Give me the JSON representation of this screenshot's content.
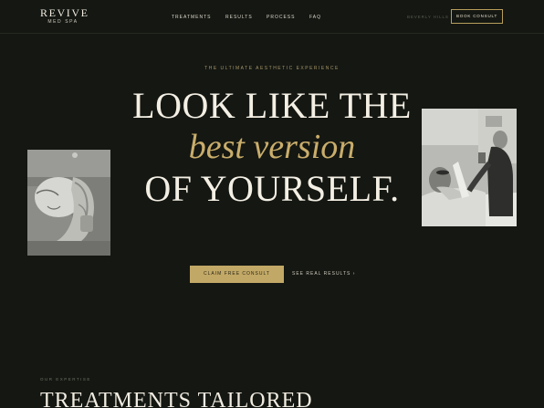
{
  "brand": {
    "name": "REVIVE",
    "subtitle": "MED SPA"
  },
  "nav": {
    "links": [
      {
        "label": "TREATMENTS"
      },
      {
        "label": "RESULTS"
      },
      {
        "label": "PROCESS"
      },
      {
        "label": "FAQ"
      }
    ],
    "location": "BEVERLY HILLS",
    "cta_label": "BOOK CONSULT"
  },
  "hero": {
    "eyebrow": "THE ULTIMATE AESTHETIC EXPERIENCE",
    "line1": "LOOK LIKE THE",
    "line2": "best version",
    "line3": "OF YOURSELF.",
    "primary_cta": "CLAIM FREE CONSULT",
    "secondary_cta": "SEE REAL RESULTS ›"
  },
  "expertise": {
    "eyebrow": "OUR EXPERTISE",
    "title": "TREATMENTS TAILORED"
  },
  "colors": {
    "background": "#141712",
    "accent_gold": "#c2a866",
    "text_light": "#f4efe4"
  }
}
